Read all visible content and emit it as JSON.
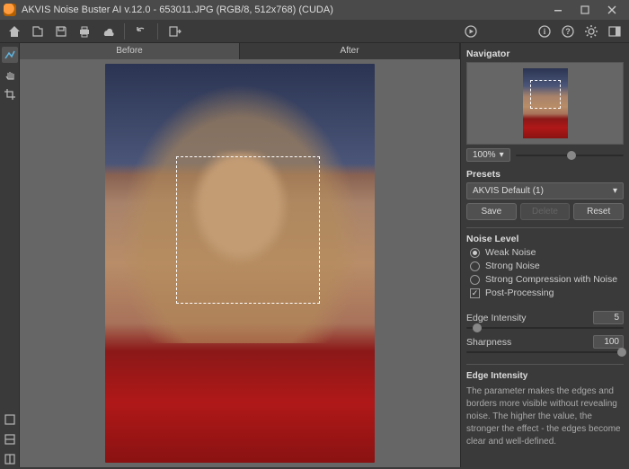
{
  "titlebar": {
    "title": "AKVIS Noise Buster AI v.12.0 - 653011.JPG (RGB/8, 512x768) (CUDA)"
  },
  "tabs": {
    "before": "Before",
    "after": "After"
  },
  "navigator": {
    "label": "Navigator"
  },
  "zoom": {
    "value": "100%"
  },
  "presets": {
    "label": "Presets",
    "selected": "AKVIS Default (1)",
    "save": "Save",
    "delete": "Delete",
    "reset": "Reset"
  },
  "noise": {
    "label": "Noise Level",
    "weak": "Weak Noise",
    "strong": "Strong Noise",
    "compress": "Strong Compression with Noise",
    "post": "Post-Processing"
  },
  "params": {
    "edge_label": "Edge Intensity",
    "edge_value": "5",
    "sharp_label": "Sharpness",
    "sharp_value": "100"
  },
  "info": {
    "heading": "Edge Intensity",
    "body": "The parameter makes the edges and borders more visible without revealing noise. The higher the value, the stronger the effect - the edges become clear and well-defined."
  }
}
